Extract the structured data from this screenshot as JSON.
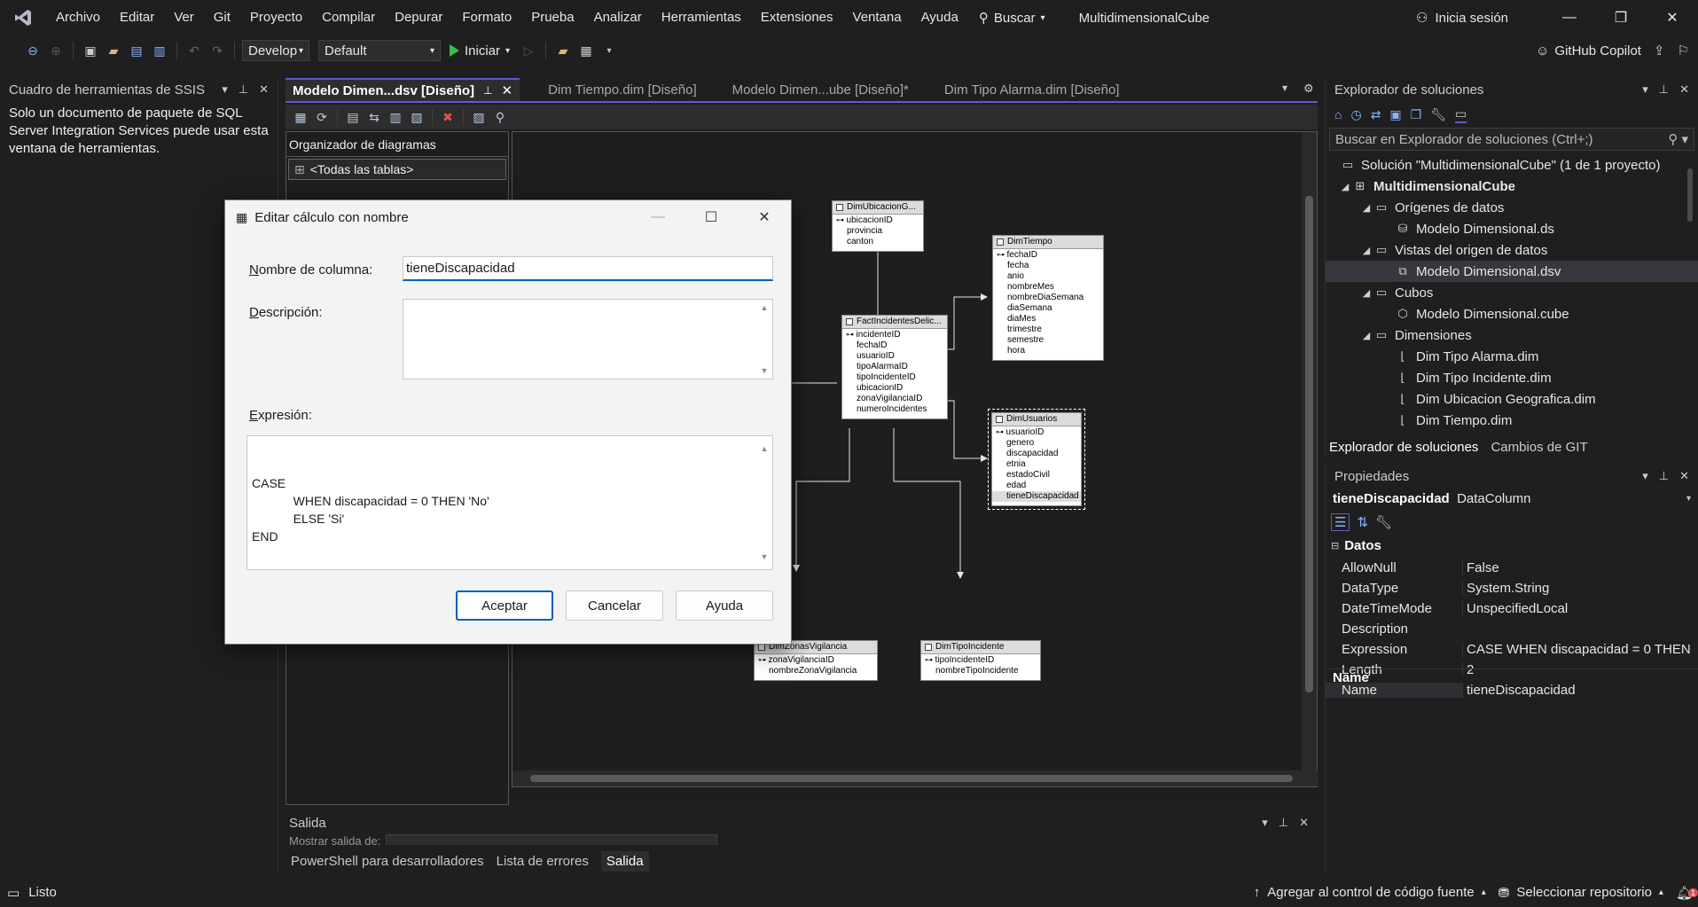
{
  "app": {
    "menu": [
      "Archivo",
      "Editar",
      "Ver",
      "Git",
      "Proyecto",
      "Compilar",
      "Depurar",
      "Formato",
      "Prueba",
      "Analizar",
      "Herramientas",
      "Extensiones",
      "Ventana",
      "Ayuda"
    ],
    "search_label": "Buscar",
    "project_name": "MultidimensionalCube",
    "sign_in": "Inicia sesión",
    "copilot": "GitHub Copilot"
  },
  "toolbar": {
    "config": "Develop",
    "platform": "Default",
    "run_label": "Iniciar"
  },
  "ssis_panel": {
    "title": "Cuadro de herramientas de SSIS",
    "body": "Solo un documento de paquete de SQL Server Integration Services puede usar esta ventana de herramientas."
  },
  "doc_tabs": [
    {
      "label": "Modelo Dimen...dsv [Diseño]",
      "active": true
    },
    {
      "label": "Dim Tiempo.dim [Diseño]",
      "active": false
    },
    {
      "label": "Modelo Dimen...ube [Diseño]*",
      "active": false
    },
    {
      "label": "Dim Tipo Alarma.dim [Diseño]",
      "active": false
    }
  ],
  "organizer": {
    "header": "Organizador de diagramas",
    "item": "<Todas las tablas>"
  },
  "diagram": {
    "tables": [
      {
        "name": "DimUbicacionG...",
        "cols": [
          "ubicacionID",
          "provincia",
          "canton"
        ],
        "keys": 1
      },
      {
        "name": "DimTiempo",
        "cols": [
          "fechaID",
          "fecha",
          "anio",
          "nombreMes",
          "nombreDiaSemana",
          "diaSemana",
          "diaMes",
          "trimestre",
          "semestre",
          "hora"
        ],
        "keys": 1
      },
      {
        "name": "FactIncidentesDelic...",
        "cols": [
          "incidenteID",
          "fechaID",
          "usuarioID",
          "tipoAlarmaID",
          "tipoIncidenteID",
          "ubicacionID",
          "zonaVigilanciaID",
          "numeroIncidentes"
        ],
        "keys": 1
      },
      {
        "name": "DimUsuarios",
        "cols": [
          "usuarioID",
          "genero",
          "discapacidad",
          "etnia",
          "estadoCivil",
          "edad",
          "tieneDiscapacidad"
        ],
        "keys": 1
      },
      {
        "name": "DimZonasVigilancia",
        "cols": [
          "zonaVigilanciaID",
          "nombreZonaVigilancia"
        ],
        "keys": 1
      },
      {
        "name": "DimTipoIncidente",
        "cols": [
          "tipoIncidenteID",
          "nombreTipoIncidente"
        ],
        "keys": 1
      }
    ]
  },
  "output": {
    "title": "Salida",
    "show_output_from": "Mostrar salida de:",
    "tabs": [
      "PowerShell para desarrolladores",
      "Lista de errores",
      "Salida"
    ]
  },
  "solution_explorer": {
    "title": "Explorador de soluciones",
    "search_placeholder": "Buscar en Explorador de soluciones (Ctrl+;)",
    "solution": "Solución \"MultidimensionalCube\" (1 de 1 proyecto)",
    "project": "MultidimensionalCube",
    "nodes": {
      "data_sources": "Orígenes de datos",
      "ds_item": "Modelo Dimensional.ds",
      "dsv_folder": "Vistas del origen de datos",
      "dsv_item": "Modelo Dimensional.dsv",
      "cubes": "Cubos",
      "cube_item": "Modelo Dimensional.cube",
      "dimensions": "Dimensiones",
      "dims": [
        "Dim Tipo Alarma.dim",
        "Dim Tipo Incidente.dim",
        "Dim Ubicacion Geografica.dim",
        "Dim Tiempo.dim"
      ]
    },
    "bottom_tabs": [
      "Explorador de soluciones",
      "Cambios de GIT"
    ]
  },
  "properties": {
    "title": "Propiedades",
    "object_name": "tieneDiscapacidad",
    "object_type": "DataColumn",
    "category": "Datos",
    "rows": [
      {
        "k": "AllowNull",
        "v": "False"
      },
      {
        "k": "DataType",
        "v": "System.String"
      },
      {
        "k": "DateTimeMode",
        "v": "UnspecifiedLocal"
      },
      {
        "k": "Description",
        "v": ""
      },
      {
        "k": "Expression",
        "v": "CASE       WHEN discapacidad = 0 THEN"
      },
      {
        "k": "Length",
        "v": "2"
      },
      {
        "k": "Name",
        "v": "tieneDiscapacidad"
      }
    ],
    "desc_title": "Name"
  },
  "status": {
    "ready": "Listo",
    "add_source": "Agregar al control de código fuente",
    "select_repo": "Seleccionar repositorio",
    "notifications": "1"
  },
  "dialog": {
    "title": "Editar cálculo con nombre",
    "column_label": "Nombre de columna:",
    "column_value": "tieneDiscapacidad",
    "description_label": "Descripción:",
    "description_value": "",
    "expression_label": "Expresión:",
    "expression_lines": [
      "CASE",
      "            WHEN discapacidad = 0 THEN 'No'",
      "            ELSE 'Si'",
      "END"
    ],
    "ok": "Aceptar",
    "cancel": "Cancelar",
    "help": "Ayuda"
  }
}
